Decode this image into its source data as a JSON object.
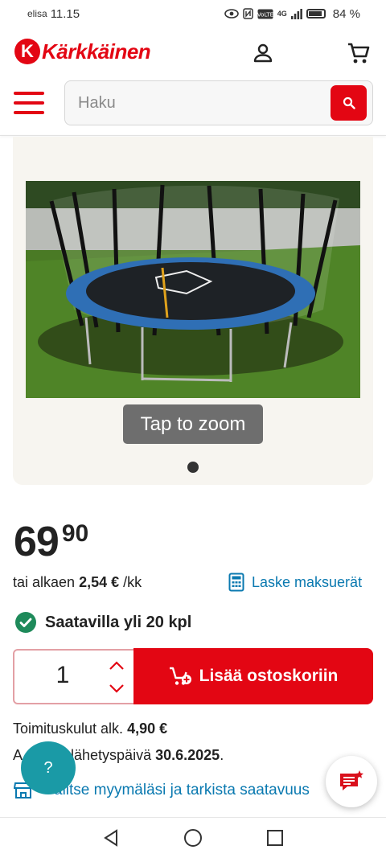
{
  "status_bar": {
    "carrier": "elisa",
    "time": "11.15",
    "network": "4G",
    "battery": "84 %"
  },
  "header": {
    "logo_text": "Kärkkäinen",
    "logo_mark": "K",
    "search_placeholder": "Haku",
    "icons": [
      "user-icon",
      "cart-icon",
      "menu-icon",
      "search-icon"
    ]
  },
  "gallery": {
    "zoom_hint": "Tap to zoom",
    "image_count": 1,
    "image_subject": "trampoline-with-safety-net"
  },
  "product": {
    "price_main": "69",
    "price_cents": "90",
    "installment_prefix": "tai alkaen",
    "installment_amount": "2,54 €",
    "installment_suffix": "/kk",
    "calc_link": "Laske maksuerät",
    "availability": "Saatavilla yli 20 kpl",
    "quantity": "1",
    "add_to_cart": "Lisää ostoskoriin",
    "shipping_label": "Toimituskulut alk.",
    "shipping_value": "4,90 €",
    "dispatch_label_visible": "Arv. lähetyspäivä",
    "dispatch_prefix": "A",
    "dispatch_rest": "lähetyspäivä",
    "dispatch_value": "30.6.2025",
    "dispatch_end": ".",
    "store_link": "Valitse myymäläsi ja tarkista saatavuus",
    "store_link_visible_part": "alitse myymäläsi ja tarkista saatavuus"
  },
  "floating": {
    "help_label": "?"
  },
  "colors": {
    "brand_red": "#e30613",
    "link_blue": "#0a79b0",
    "available_green": "#1e8a5a",
    "help_teal": "#1a9aa6"
  }
}
